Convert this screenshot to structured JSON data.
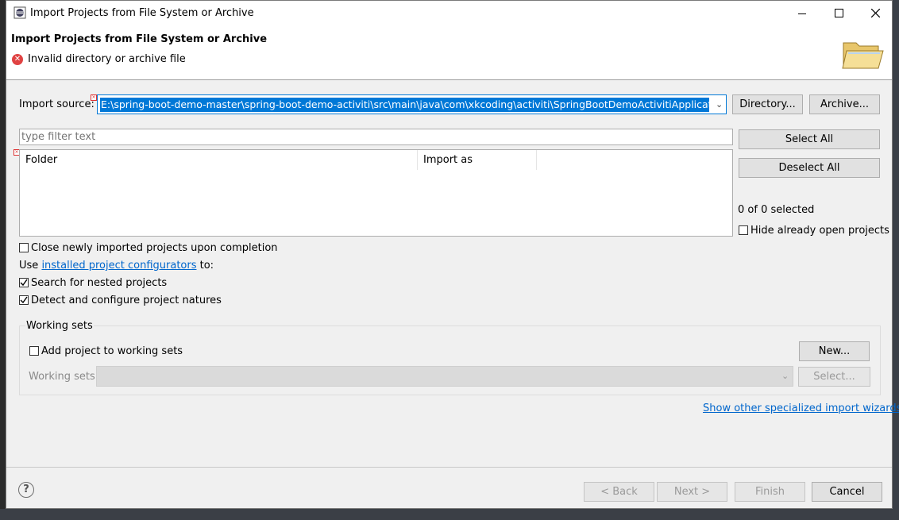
{
  "window": {
    "title": "Import Projects from File System or Archive"
  },
  "header": {
    "title": "Import Projects from File System or Archive",
    "error_message": "Invalid directory or archive file"
  },
  "source": {
    "label": "Import source:",
    "value": "E:\\spring-boot-demo-master\\spring-boot-demo-activiti\\src\\main\\java\\com\\xkcoding\\activiti\\SpringBootDemoActivitiApplication.java",
    "directory_button": "Directory...",
    "archive_button": "Archive..."
  },
  "filter": {
    "placeholder": "type filter text"
  },
  "table": {
    "columns": [
      "Folder",
      "Import as"
    ]
  },
  "buttons": {
    "select_all": "Select All",
    "deselect_all": "Deselect All"
  },
  "selection": {
    "count_text": "0 of 0 selected",
    "hide_open_label": "Hide already open projects",
    "hide_open_checked": false
  },
  "options": {
    "close_imported_label": "Close newly imported projects upon completion",
    "close_imported_checked": false,
    "use_prefix": "Use",
    "configurators_link": "installed project configurators",
    "use_suffix": "to:",
    "nested_label": "Search for nested projects",
    "nested_checked": true,
    "natures_label": "Detect and configure project natures",
    "natures_checked": true
  },
  "working_sets": {
    "group_label": "Working sets",
    "add_label": "Add project to working sets",
    "add_checked": false,
    "new_button": "New...",
    "sets_label": "Working sets:",
    "select_button": "Select..."
  },
  "wizards_link": "Show other specialized import wizards",
  "footer": {
    "back": "< Back",
    "next": "Next >",
    "finish": "Finish",
    "cancel": "Cancel"
  },
  "colors": {
    "accent": "#0078d7",
    "error": "#e04343",
    "link": "#0066cc"
  }
}
